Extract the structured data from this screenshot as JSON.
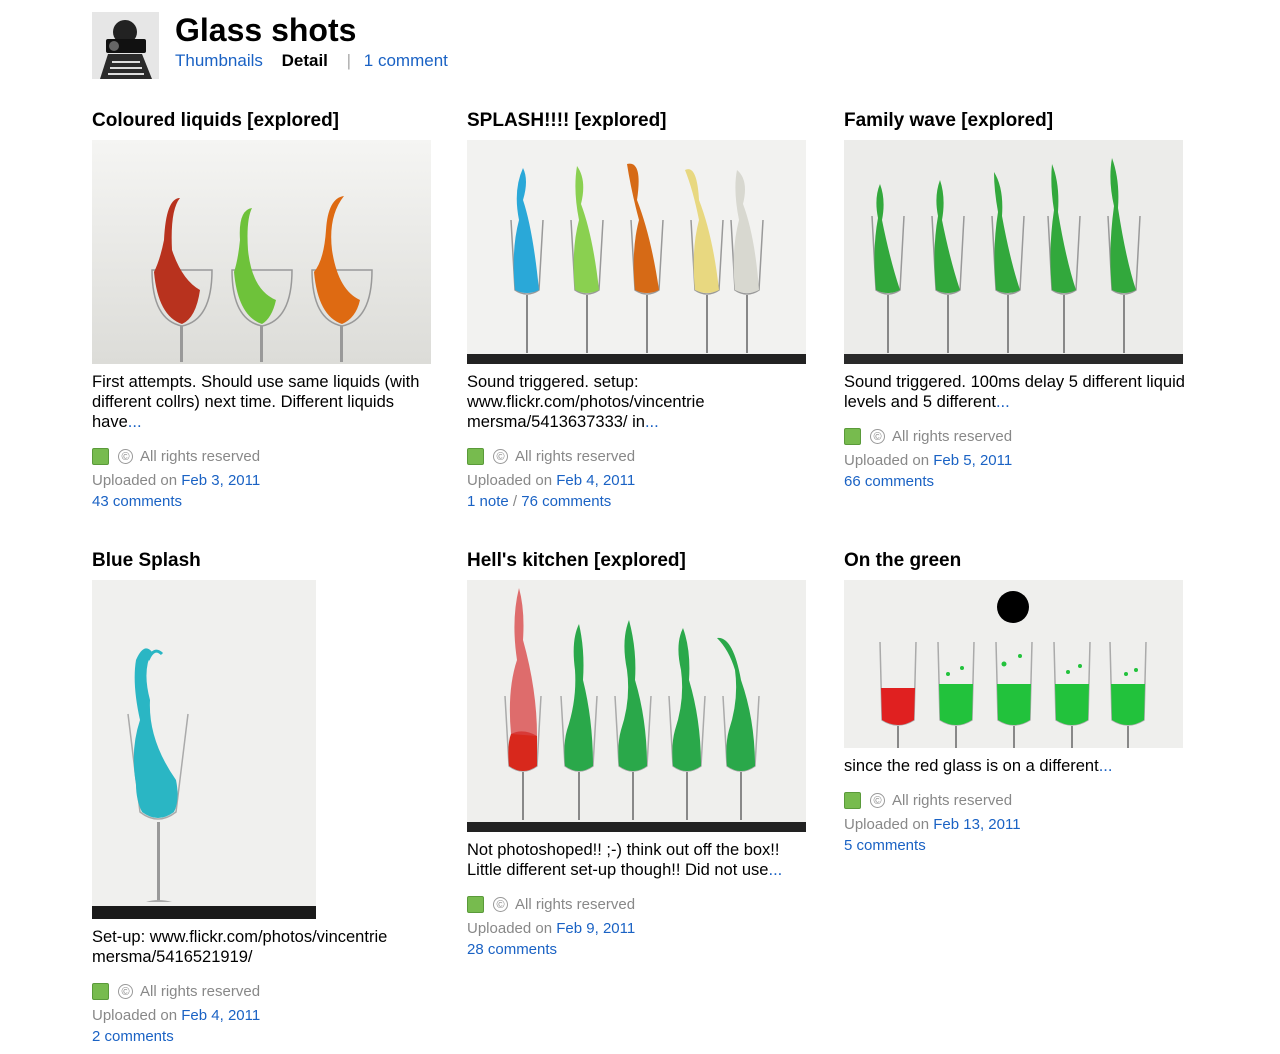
{
  "set": {
    "title": "Glass shots",
    "nav": {
      "thumbnails": "Thumbnails",
      "detail": "Detail",
      "comments": "1 comment"
    }
  },
  "photos": [
    {
      "title": "Coloured liquids [explored]",
      "desc": "First attempts. Should use same liquids (with different collrs) next time. Different liquids have",
      "more": "...",
      "license": "All rights reserved",
      "uploaded_prefix": "Uploaded on",
      "date": "Feb 3, 2011",
      "notes": "",
      "comments": "43 comments"
    },
    {
      "title": "SPLASH!!!! [explored]",
      "desc": "Sound triggered. setup: www.flickr.com/photos/vincentrie mersma/5413637333/ in",
      "more": "...",
      "license": "All rights reserved",
      "uploaded_prefix": "Uploaded on",
      "date": "Feb 4, 2011",
      "notes": "1 note",
      "slash": "/",
      "comments": "76 comments"
    },
    {
      "title": "Family wave [explored]",
      "desc": "Sound triggered. 100ms delay 5 different liquid levels and 5 different",
      "more": "...",
      "license": "All rights reserved",
      "uploaded_prefix": "Uploaded on",
      "date": "Feb 5, 2011",
      "notes": "",
      "comments": "66 comments"
    },
    {
      "title": "Blue Splash",
      "desc": "Set-up: www.flickr.com/photos/vincentrie mersma/5416521919/",
      "more": "",
      "license": "All rights reserved",
      "uploaded_prefix": "Uploaded on",
      "date": "Feb 4, 2011",
      "notes": "",
      "comments": "2 comments"
    },
    {
      "title": "Hell's kitchen [explored]",
      "desc": "Not photoshoped!! ;-) think out off the box!! Little different set-up though!! Did not use",
      "more": "...",
      "license": "All rights reserved",
      "uploaded_prefix": "Uploaded on",
      "date": "Feb 9, 2011",
      "notes": "",
      "comments": "28 comments"
    },
    {
      "title": "On the green",
      "desc": "since the red glass is on a different",
      "more": "...",
      "license": "All rights reserved",
      "uploaded_prefix": "Uploaded on",
      "date": "Feb 13, 2011",
      "notes": "",
      "comments": "5 comments"
    }
  ],
  "colors": {
    "link": "#1a62c4",
    "license_green": "#77bb4e",
    "meta_gray": "#888888"
  },
  "icons": [
    "photographer-avatar",
    "license-green-icon",
    "copyright-icon"
  ]
}
